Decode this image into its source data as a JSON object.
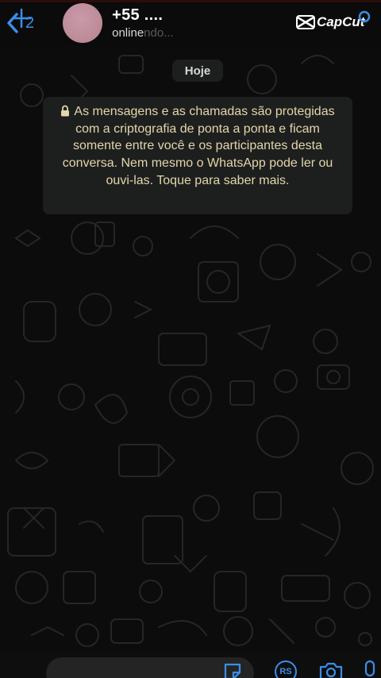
{
  "header": {
    "back_count": "2",
    "contact_name": "+55 ....",
    "status": "online",
    "status_ghost": "ndo...",
    "capcut_label": "CapCut"
  },
  "chat": {
    "date_label": "Hoje",
    "encryption_notice": "As mensagens e as chamadas são protegidas com a criptografia de ponta a ponta e ficam somente entre você e os participantes desta conversa. Nem mesmo o WhatsApp pode ler ou ouvi-las. Toque para saber mais."
  },
  "composer": {
    "rs_label": "RS"
  },
  "colors": {
    "accent": "#3a8fe8",
    "notice_text": "#e4d6a9",
    "bubble_bg": "#1d1f1f",
    "avatar": "#c08d9b"
  },
  "icons": [
    "back-chevron-icon",
    "lock-icon",
    "plus-icon",
    "sticker-icon",
    "camera-icon",
    "mic-icon",
    "call-icon",
    "capcut-logo-icon"
  ]
}
